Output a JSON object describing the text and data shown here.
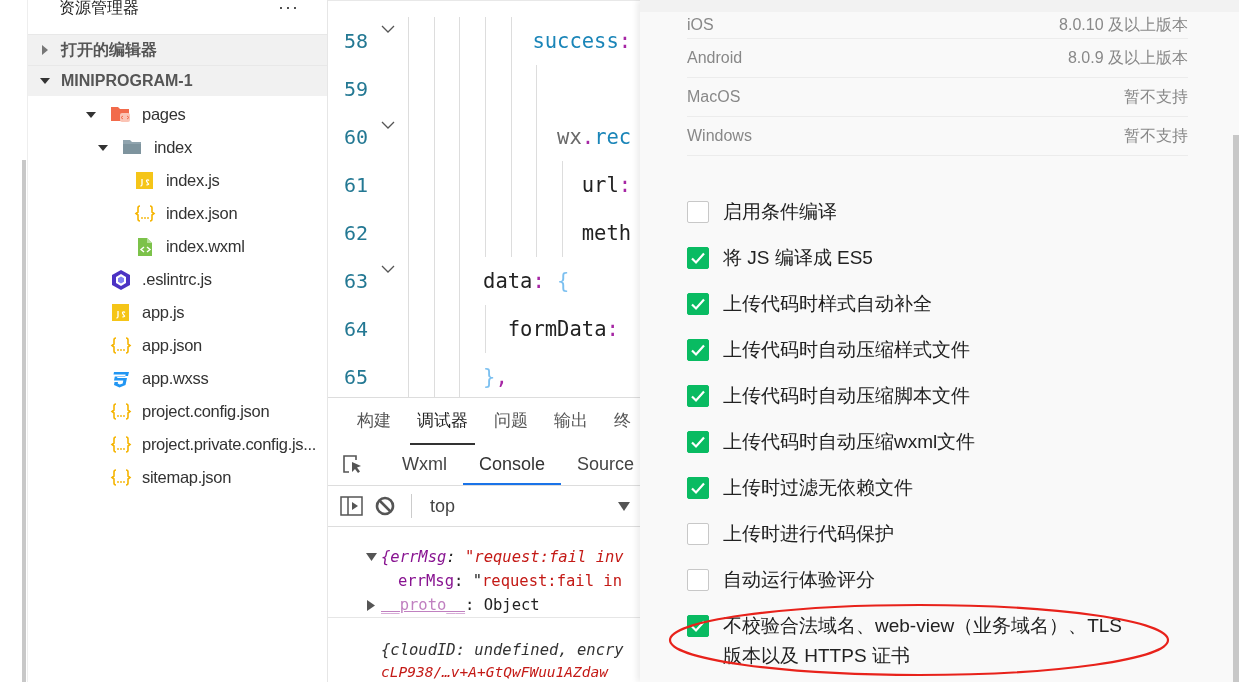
{
  "explorer": {
    "title": "资源管理器",
    "more": "···",
    "sections": [
      {
        "label": "打开的编辑器",
        "expanded": false
      },
      {
        "label": "MINIPROGRAM-1",
        "expanded": true
      }
    ],
    "tree": [
      {
        "name": "pages",
        "kind": "pages-folder",
        "expanded": true,
        "children": [
          {
            "name": "index",
            "kind": "folder",
            "expanded": true,
            "children": [
              {
                "name": "index.js",
                "kind": "js"
              },
              {
                "name": "index.json",
                "kind": "json"
              },
              {
                "name": "index.wxml",
                "kind": "wxml"
              }
            ]
          }
        ]
      },
      {
        "name": ".eslintrc.js",
        "kind": "eslint"
      },
      {
        "name": "app.js",
        "kind": "js"
      },
      {
        "name": "app.json",
        "kind": "json"
      },
      {
        "name": "app.wxss",
        "kind": "css"
      },
      {
        "name": "project.config.json",
        "kind": "json"
      },
      {
        "name": "project.private.config.js...",
        "kind": "json"
      },
      {
        "name": "sitemap.json",
        "kind": "json"
      }
    ]
  },
  "editor": {
    "lines": [
      {
        "number": "58",
        "foldable": true,
        "tokens": [
          {
            "text": "          success",
            "kind": "property"
          },
          {
            "text": ":",
            "kind": "punct"
          }
        ]
      },
      {
        "number": "59",
        "foldable": false
      },
      {
        "number": "60",
        "foldable": true,
        "tokens": [
          {
            "text": "            wx",
            "kind": "object"
          },
          {
            "text": ".",
            "kind": "punct"
          },
          {
            "text": "rec",
            "kind": "property"
          }
        ]
      },
      {
        "number": "61",
        "foldable": false,
        "tokens": [
          {
            "text": "              url",
            "kind": "plain"
          },
          {
            "text": ":",
            "kind": "punct"
          }
        ]
      },
      {
        "number": "62",
        "foldable": false,
        "tokens": [
          {
            "text": "              meth",
            "kind": "plain"
          }
        ]
      },
      {
        "number": "63",
        "foldable": true,
        "tokens": [
          {
            "text": "      data",
            "kind": "plain"
          },
          {
            "text": ":",
            "kind": "punct"
          },
          {
            "text": " {",
            "kind": "brace"
          }
        ]
      },
      {
        "number": "64",
        "foldable": false,
        "tokens": [
          {
            "text": "        formData",
            "kind": "plain"
          },
          {
            "text": ":",
            "kind": "punct"
          }
        ]
      },
      {
        "number": "65",
        "foldable": false,
        "tokens": [
          {
            "text": "      }",
            "kind": "brace"
          },
          {
            "text": ",",
            "kind": "punct"
          }
        ]
      }
    ]
  },
  "devtools": {
    "tabs": [
      {
        "label": "构建",
        "selected": false
      },
      {
        "label": "调试器",
        "selected": true
      },
      {
        "label": "问题",
        "selected": false
      },
      {
        "label": "输出",
        "selected": false
      },
      {
        "label": "终",
        "selected": false
      }
    ],
    "subtabs": [
      {
        "label": "Wxml",
        "selected": false
      },
      {
        "label": "Console",
        "selected": true
      },
      {
        "label": "Source",
        "selected": false
      }
    ],
    "context": "top",
    "console": [
      {
        "kind": "object",
        "expanded": true,
        "tokens": [
          {
            "text": "{errMsg",
            "kind": "key"
          },
          {
            "text": ": ",
            "kind": "punct"
          },
          {
            "text": "\"request:fail inv",
            "kind": "string"
          }
        ]
      },
      {
        "kind": "property",
        "tokens": [
          {
            "text": "errMsg",
            "kind": "key"
          },
          {
            "text": ": ",
            "kind": "punct"
          },
          {
            "text": "\"",
            "kind": "punct"
          },
          {
            "text": "request:fail in",
            "kind": "string"
          }
        ]
      },
      {
        "kind": "object",
        "expanded": false,
        "tokens": [
          {
            "text": "__proto__",
            "kind": "proto"
          },
          {
            "text": ": Object",
            "kind": "punct"
          }
        ]
      },
      {
        "kind": "message",
        "tokens": [
          {
            "text": "{cloudID: undefined, encry",
            "kind": "italic"
          }
        ]
      },
      {
        "kind": "message",
        "tokens": [
          {
            "text": "cLP938/…v+A+GtQwFWuu1AZdaw",
            "kind": "string"
          }
        ]
      }
    ]
  },
  "settings": {
    "platforms": [
      {
        "name": "iOS",
        "value": "8.0.10 及以上版本"
      },
      {
        "name": "Android",
        "value": "8.0.9 及以上版本"
      },
      {
        "name": "MacOS",
        "value": "暂不支持"
      },
      {
        "name": "Windows",
        "value": "暂不支持"
      }
    ],
    "options": [
      {
        "label": "启用条件编译",
        "checked": false,
        "highlighted": false
      },
      {
        "label": "将 JS 编译成 ES5",
        "checked": true,
        "highlighted": false
      },
      {
        "label": "上传代码时样式自动补全",
        "checked": true,
        "highlighted": false
      },
      {
        "label": "上传代码时自动压缩样式文件",
        "checked": true,
        "highlighted": false
      },
      {
        "label": "上传代码时自动压缩脚本文件",
        "checked": true,
        "highlighted": false
      },
      {
        "label": "上传代码时自动压缩wxml文件",
        "checked": true,
        "highlighted": false
      },
      {
        "label": "上传时过滤无依赖文件",
        "checked": true,
        "highlighted": false
      },
      {
        "label": "上传时进行代码保护",
        "checked": false,
        "highlighted": false
      },
      {
        "label": "自动运行体验评分",
        "checked": false,
        "highlighted": false
      },
      {
        "label": "不校验合法域名、web-view（业务域名）、TLS 版本以及 HTTPS 证书",
        "checked": true,
        "highlighted": true
      }
    ]
  }
}
